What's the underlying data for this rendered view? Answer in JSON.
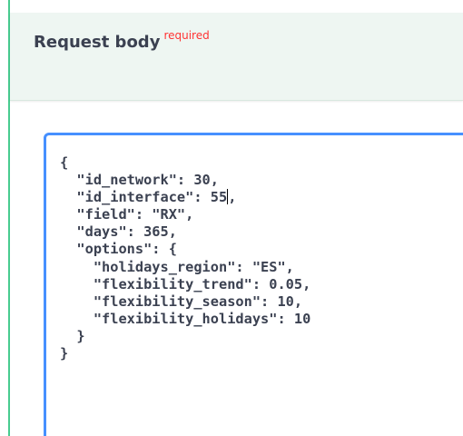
{
  "request_body": {
    "title": "Request body",
    "required_label": "required",
    "accent_color": "#49cc90",
    "editor_focus_color": "#4690ff",
    "code_before_caret": "{\n  \"id_network\": 30,\n  \"id_interface\": 55",
    "code_after_caret": ",\n  \"field\": \"RX\",\n  \"days\": 365,\n  \"options\": {\n    \"holidays_region\": \"ES\",\n    \"flexibility_trend\": 0.05,\n    \"flexibility_season\": 10,\n    \"flexibility_holidays\": 10\n  }\n}"
  }
}
